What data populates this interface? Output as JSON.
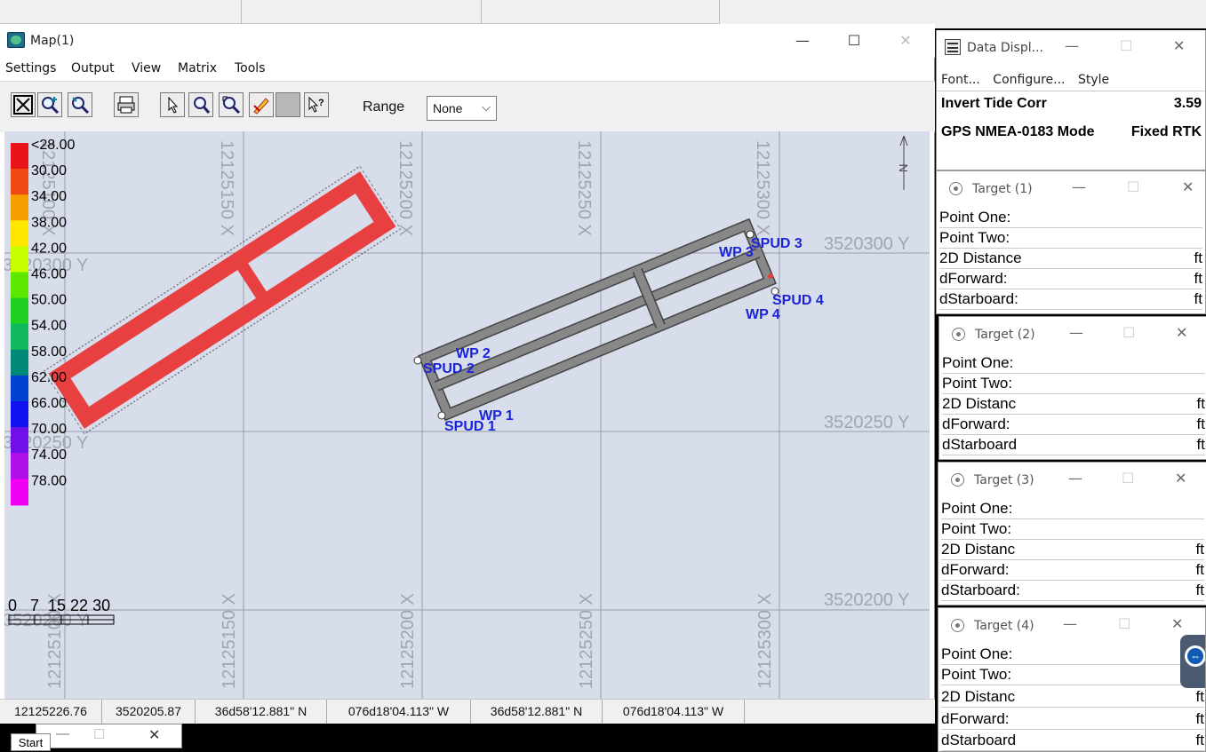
{
  "map_window": {
    "title": "Map(1)",
    "menu": [
      "Settings",
      "Output",
      "View",
      "Matrix",
      "Tools"
    ],
    "range_label": "Range",
    "range_value": "None",
    "grid_x_labels": [
      "12125150 X",
      "12125200 X",
      "12125250 X",
      "12125300 X",
      "12125100 X"
    ],
    "grid_y_labels": [
      "3520300 Y",
      "3520250 Y",
      "3520200 Y"
    ],
    "north_label": "N",
    "legend": [
      "<28.00",
      "30.00",
      "34.00",
      "38.00",
      "42.00",
      "46.00",
      "50.00",
      "54.00",
      "58.00",
      "62.00",
      "66.00",
      "70.00",
      "74.00",
      "78.00"
    ],
    "legend_colors": [
      "#e8141a",
      "#f04a14",
      "#f5a000",
      "#ffe800",
      "#c8ff00",
      "#5ee800",
      "#20d020",
      "#10b860",
      "#008878",
      "#0040d0",
      "#1010f0",
      "#7010e8",
      "#b010e8",
      "#f000f0"
    ],
    "scale_bar_label": "0   7  15 22 30",
    "markers": [
      "SPUD 3",
      "WP 3",
      "SPUD 4",
      "WP 4",
      "WP 2",
      "SPUD 2",
      "WP 1",
      "SPUD 1"
    ],
    "status": [
      "12125226.76",
      "3520205.87",
      "36d58'12.881\" N",
      "076d18'04.113\" W",
      "36d58'12.881\" N",
      "076d18'04.113\" W"
    ]
  },
  "data_display": {
    "title": "Data Displ...",
    "menu": [
      "Font...",
      "Configure...",
      "Style"
    ],
    "rows": [
      {
        "label": "Invert Tide Corr",
        "value": "3.59"
      },
      {
        "label": "GPS NMEA-0183 Mode",
        "value": "Fixed RTK"
      }
    ]
  },
  "targets": [
    {
      "title": "Target (1)",
      "rows": [
        {
          "label": "Point One:",
          "unit": ""
        },
        {
          "label": "Point Two:",
          "unit": ""
        },
        {
          "label": "2D Distance",
          "unit": "ft"
        },
        {
          "label": "dForward:",
          "unit": "ft"
        },
        {
          "label": "dStarboard:",
          "unit": "ft"
        }
      ]
    },
    {
      "title": "Target (2)",
      "rows": [
        {
          "label": "Point One:",
          "unit": ""
        },
        {
          "label": "Point Two:",
          "unit": ""
        },
        {
          "label": "2D Distanc",
          "unit": "ft"
        },
        {
          "label": "dForward:",
          "unit": "ft"
        },
        {
          "label": "dStarboard",
          "unit": "ft"
        }
      ]
    },
    {
      "title": "Target (3)",
      "rows": [
        {
          "label": "Point One:",
          "unit": ""
        },
        {
          "label": "Point Two:",
          "unit": ""
        },
        {
          "label": "2D Distanc",
          "unit": "ft"
        },
        {
          "label": "dForward:",
          "unit": "ft"
        },
        {
          "label": "dStarboard:",
          "unit": "ft"
        }
      ]
    },
    {
      "title": "Target (4)",
      "rows": [
        {
          "label": "Point One:",
          "unit": ""
        },
        {
          "label": "Point Two:",
          "unit": ""
        },
        {
          "label": "2D Distanc",
          "unit": "ft"
        },
        {
          "label": "dForward:",
          "unit": "ft"
        },
        {
          "label": "dStarboard",
          "unit": "ft"
        }
      ]
    }
  ],
  "taskbar": {
    "start": "Start"
  },
  "icons": [
    "map-app-icon",
    "zoom-extents-icon",
    "zoom-in-icon",
    "zoom-out-icon",
    "print-icon",
    "pointer-icon",
    "zoom-window-icon",
    "pan-icon",
    "edit-icon",
    "help-pointer-icon",
    "data-display-icon",
    "target-icon"
  ]
}
